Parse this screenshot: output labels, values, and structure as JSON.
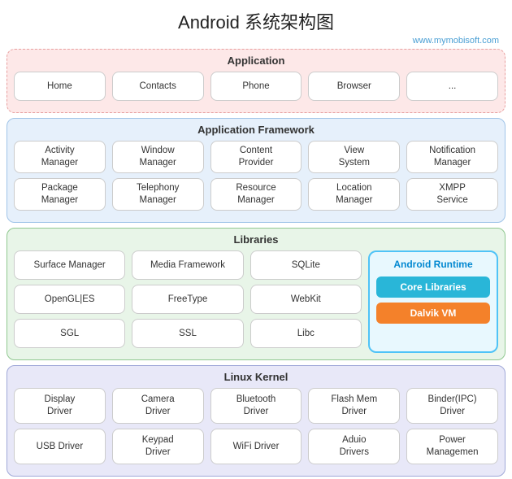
{
  "page": {
    "title": "Android  系统架构图",
    "watermark": "www.mymobisoft.com"
  },
  "app_layer": {
    "title": "Application",
    "buttons": [
      "Home",
      "Contacts",
      "Phone",
      "Browser",
      "..."
    ]
  },
  "framework_layer": {
    "title": "Application Framework",
    "row1": [
      "Activity\nManager",
      "Window\nManager",
      "Content\nProvider",
      "View\nSystem",
      "Notification\nManager"
    ],
    "row2": [
      "Package\nManager",
      "Telephony\nManager",
      "Resource\nManager",
      "Location\nManager",
      "XMPP\nService"
    ]
  },
  "libraries_layer": {
    "title": "Libraries",
    "row1": [
      "Surface Manager",
      "Media Framework",
      "SQLite"
    ],
    "row2": [
      "OpenGL|ES",
      "FreeType",
      "WebKit"
    ],
    "row3": [
      "SGL",
      "SSL",
      "Libc"
    ]
  },
  "runtime": {
    "title": "Android Runtime",
    "core": "Core Libraries",
    "dalvik": "Dalvik VM"
  },
  "kernel_layer": {
    "title": "Linux Kernel",
    "row1": [
      "Display\nDriver",
      "Camera\nDriver",
      "Bluetooth\nDriver",
      "Flash Mem\nDriver",
      "Binder(IPC)\nDriver"
    ],
    "row2": [
      "USB Driver",
      "Keypad\nDriver",
      "WiFi Driver",
      "Aduio\nDrivers",
      "Power\nManagemen"
    ]
  }
}
